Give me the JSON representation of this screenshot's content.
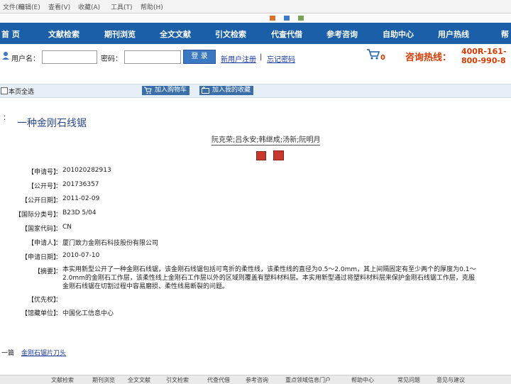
{
  "browser_menu": [
    "文件(F)",
    "编辑(E)",
    "查看(V)",
    "收藏(A)",
    "工具(T)",
    "帮助(H)"
  ],
  "nav": {
    "items": [
      "首 页",
      "文献检索",
      "期刊浏览",
      "全文文献",
      "引文检索",
      "代查代借",
      "参考咨询",
      "自助中心",
      "用户热线",
      "帮"
    ]
  },
  "login": {
    "username_label": "用户名：",
    "password_label": "密码：",
    "login_button": "登 录",
    "register_link": "新用户注册",
    "separator": "|",
    "forgot_link": "忘记密码",
    "cart_count": "0",
    "hotline_label": "咨询热线：",
    "hotline_1": "400R-161-",
    "hotline_2": "800-990-8"
  },
  "actions": {
    "select_all": "本页全选",
    "add_cart": "加入购物车",
    "add_favorite": "加入我的收藏"
  },
  "record": {
    "title_prefix": "：",
    "title": "一种金刚石线锯",
    "authors": "阮克荣;吕永安;韩继成;汤新;阮明月",
    "fields": [
      {
        "key": "【申请号】",
        "value": "201020282913"
      },
      {
        "key": "【公开号】",
        "value": "201736357"
      },
      {
        "key": "【公开日期】",
        "value": "2011-02-09"
      },
      {
        "key": "【国际分类号】",
        "value": "B23D 5/04"
      },
      {
        "key": "【国家代码】",
        "value": "CN"
      },
      {
        "key": "【申请人】",
        "value": "厦门致力金刚石科技股份有限公司"
      },
      {
        "key": "【申请日期】",
        "value": "2010-07-10"
      }
    ],
    "abstract_key": "【摘要】",
    "abstract": "本实用新型公开了一种金刚石线锯，该金刚石线锯包括可弯折的柔性线，该柔性线的直径为0.5～2.0mm，其上间隔固定有至少两个的厚度为0.1～2.0mm的金刚石工作层，该柔性线上金刚石工作层以外的区域则覆盖有塑料材料层。本实用新型通过将塑料材料层来保护金刚石线锯工作层，克服金刚石线锯在切割过程中容易磨损、柔性线易断裂的问题。",
    "priority_key": "【优先权】",
    "priority": "",
    "agency_key": "【馆藏单位】",
    "agency": "中国化工信息中心"
  },
  "related": {
    "label": "一篇",
    "link": "金刚石锯片刀头"
  },
  "footer": [
    "文献检索",
    "期刊浏览",
    "全文文献",
    "引文检索",
    "代查代借",
    "参考咨询",
    "重点领域信息门户",
    "帮助中心",
    "常见问题",
    "意见与建议"
  ],
  "colors": {
    "nav_bg": "#1a5fa8",
    "hotline": "#d83a00",
    "link": "#1a3aa0"
  }
}
